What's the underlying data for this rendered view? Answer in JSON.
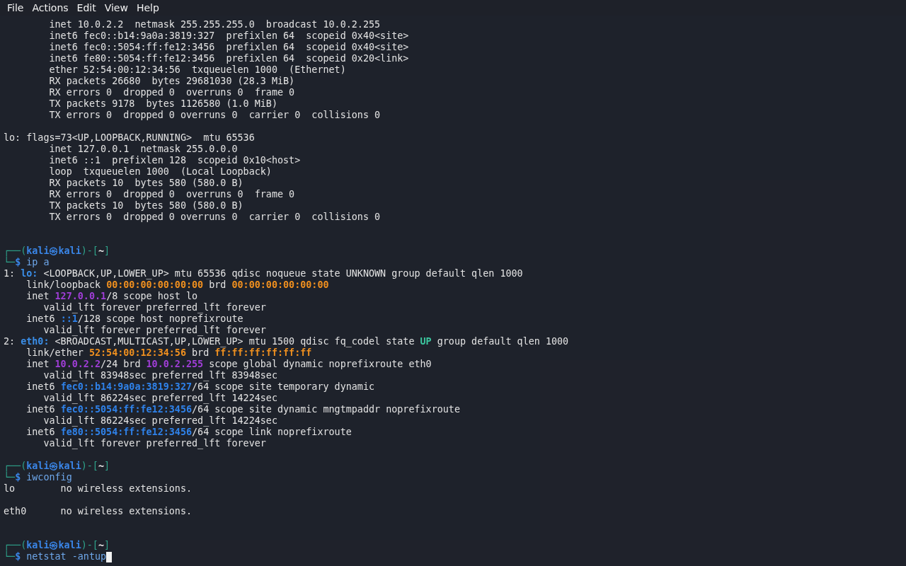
{
  "menu_bar": {
    "items": [
      "File",
      "Actions",
      "Edit",
      "View",
      "Help"
    ]
  },
  "terminal": {
    "lines": [
      {
        "segments": [
          {
            "text": "        inet 10.0.2.2  netmask 255.255.255.0  broadcast 10.0.2.255",
            "kind": "plain"
          }
        ]
      },
      {
        "segments": [
          {
            "text": "        inet6 fec0::b14:9a0a:3819:327  prefixlen 64  scopeid 0x40<site>",
            "kind": "plain"
          }
        ]
      },
      {
        "segments": [
          {
            "text": "        inet6 fec0::5054:ff:fe12:3456  prefixlen 64  scopeid 0x40<site>",
            "kind": "plain"
          }
        ]
      },
      {
        "segments": [
          {
            "text": "        inet6 fe80::5054:ff:fe12:3456  prefixlen 64  scopeid 0x20<link>",
            "kind": "plain"
          }
        ]
      },
      {
        "segments": [
          {
            "text": "        ether 52:54:00:12:34:56  txqueuelen 1000  (Ethernet)",
            "kind": "plain"
          }
        ]
      },
      {
        "segments": [
          {
            "text": "        RX packets 26680  bytes 29681030 (28.3 MiB)",
            "kind": "plain"
          }
        ]
      },
      {
        "segments": [
          {
            "text": "        RX errors 0  dropped 0  overruns 0  frame 0",
            "kind": "plain"
          }
        ]
      },
      {
        "segments": [
          {
            "text": "        TX packets 9178  bytes 1126580 (1.0 MiB)",
            "kind": "plain"
          }
        ]
      },
      {
        "segments": [
          {
            "text": "        TX errors 0  dropped 0 overruns 0  carrier 0  collisions 0",
            "kind": "plain"
          }
        ]
      },
      {
        "kind": "blank"
      },
      {
        "segments": [
          {
            "text": "lo: flags=73<UP,LOOPBACK,RUNNING>  mtu 65536",
            "kind": "plain"
          }
        ]
      },
      {
        "segments": [
          {
            "text": "        inet 127.0.0.1  netmask 255.0.0.0",
            "kind": "plain"
          }
        ]
      },
      {
        "segments": [
          {
            "text": "        inet6 ::1  prefixlen 128  scopeid 0x10<host>",
            "kind": "plain"
          }
        ]
      },
      {
        "segments": [
          {
            "text": "        loop  txqueuelen 1000  (Local Loopback)",
            "kind": "plain"
          }
        ]
      },
      {
        "segments": [
          {
            "text": "        RX packets 10  bytes 580 (580.0 B)",
            "kind": "plain"
          }
        ]
      },
      {
        "segments": [
          {
            "text": "        RX errors 0  dropped 0  overruns 0  frame 0",
            "kind": "plain"
          }
        ]
      },
      {
        "segments": [
          {
            "text": "        TX packets 10  bytes 580 (580.0 B)",
            "kind": "plain"
          }
        ]
      },
      {
        "segments": [
          {
            "text": "        TX errors 0  dropped 0 overruns 0  carrier 0  collisions 0",
            "kind": "plain"
          }
        ]
      },
      {
        "kind": "blank"
      },
      {
        "kind": "blank"
      },
      {
        "segments": [
          {
            "text": "┌──(",
            "kind": "frame"
          },
          {
            "text": "kali㉿kali",
            "kind": "user"
          },
          {
            "text": ")-[",
            "kind": "frame"
          },
          {
            "text": "~",
            "kind": "dir"
          },
          {
            "text": "]",
            "kind": "frame"
          }
        ]
      },
      {
        "segments": [
          {
            "text": "└─",
            "kind": "frame"
          },
          {
            "text": "$",
            "kind": "user"
          },
          {
            "text": " ip a",
            "kind": "command"
          }
        ]
      },
      {
        "segments": [
          {
            "text": "1: ",
            "kind": "plain"
          },
          {
            "text": "lo:",
            "kind": "iface"
          },
          {
            "text": " <LOOPBACK,UP,LOWER_UP> mtu 65536 qdisc noqueue state UNKNOWN group default qlen 1000",
            "kind": "plain"
          }
        ]
      },
      {
        "segments": [
          {
            "text": "    link/loopback ",
            "kind": "plain"
          },
          {
            "text": "00:00:00:00:00:00",
            "kind": "mac"
          },
          {
            "text": " brd ",
            "kind": "plain"
          },
          {
            "text": "00:00:00:00:00:00",
            "kind": "mac"
          }
        ]
      },
      {
        "segments": [
          {
            "text": "    inet ",
            "kind": "plain"
          },
          {
            "text": "127.0.0.1",
            "kind": "ipv4"
          },
          {
            "text": "/8 scope host lo",
            "kind": "plain"
          }
        ]
      },
      {
        "segments": [
          {
            "text": "       valid_lft forever preferred_lft forever",
            "kind": "plain"
          }
        ]
      },
      {
        "segments": [
          {
            "text": "    inet6 ",
            "kind": "plain"
          },
          {
            "text": "::1",
            "kind": "ipv6"
          },
          {
            "text": "/128 scope host noprefixroute",
            "kind": "plain"
          }
        ]
      },
      {
        "segments": [
          {
            "text": "       valid_lft forever preferred_lft forever",
            "kind": "plain"
          }
        ]
      },
      {
        "segments": [
          {
            "text": "2: ",
            "kind": "plain"
          },
          {
            "text": "eth0:",
            "kind": "iface"
          },
          {
            "text": " <BROADCAST,MULTICAST,UP,LOWER_UP> mtu 1500 qdisc fq_codel state ",
            "kind": "plain"
          },
          {
            "text": "UP",
            "kind": "state"
          },
          {
            "text": " group default qlen 1000",
            "kind": "plain"
          }
        ]
      },
      {
        "segments": [
          {
            "text": "    link/ether ",
            "kind": "plain"
          },
          {
            "text": "52:54:00:12:34:56",
            "kind": "mac"
          },
          {
            "text": " brd ",
            "kind": "plain"
          },
          {
            "text": "ff:ff:ff:ff:ff:ff",
            "kind": "mac"
          }
        ]
      },
      {
        "segments": [
          {
            "text": "    inet ",
            "kind": "plain"
          },
          {
            "text": "10.0.2.2",
            "kind": "ipv4"
          },
          {
            "text": "/24 brd ",
            "kind": "plain"
          },
          {
            "text": "10.0.2.255",
            "kind": "ipv4"
          },
          {
            "text": " scope global dynamic noprefixroute eth0",
            "kind": "plain"
          }
        ]
      },
      {
        "segments": [
          {
            "text": "       valid_lft 83948sec preferred_lft 83948sec",
            "kind": "plain"
          }
        ]
      },
      {
        "segments": [
          {
            "text": "    inet6 ",
            "kind": "plain"
          },
          {
            "text": "fec0::b14:9a0a:3819:327",
            "kind": "ipv6"
          },
          {
            "text": "/64 scope site temporary dynamic",
            "kind": "plain"
          }
        ]
      },
      {
        "segments": [
          {
            "text": "       valid_lft 86224sec preferred_lft 14224sec",
            "kind": "plain"
          }
        ]
      },
      {
        "segments": [
          {
            "text": "    inet6 ",
            "kind": "plain"
          },
          {
            "text": "fec0::5054:ff:fe12:3456",
            "kind": "ipv6"
          },
          {
            "text": "/64 scope site dynamic mngtmpaddr noprefixroute",
            "kind": "plain"
          }
        ]
      },
      {
        "segments": [
          {
            "text": "       valid_lft 86224sec preferred_lft 14224sec",
            "kind": "plain"
          }
        ]
      },
      {
        "segments": [
          {
            "text": "    inet6 ",
            "kind": "plain"
          },
          {
            "text": "fe80::5054:ff:fe12:3456",
            "kind": "ipv6"
          },
          {
            "text": "/64 scope link noprefixroute",
            "kind": "plain"
          }
        ]
      },
      {
        "segments": [
          {
            "text": "       valid_lft forever preferred_lft forever",
            "kind": "plain"
          }
        ]
      },
      {
        "kind": "blank"
      },
      {
        "segments": [
          {
            "text": "┌──(",
            "kind": "frame"
          },
          {
            "text": "kali㉿kali",
            "kind": "user"
          },
          {
            "text": ")-[",
            "kind": "frame"
          },
          {
            "text": "~",
            "kind": "dir"
          },
          {
            "text": "]",
            "kind": "frame"
          }
        ]
      },
      {
        "segments": [
          {
            "text": "└─",
            "kind": "frame"
          },
          {
            "text": "$",
            "kind": "user"
          },
          {
            "text": " iwconfig",
            "kind": "command"
          }
        ]
      },
      {
        "segments": [
          {
            "text": "lo        no wireless extensions.",
            "kind": "plain"
          }
        ]
      },
      {
        "kind": "blank"
      },
      {
        "segments": [
          {
            "text": "eth0      no wireless extensions.",
            "kind": "plain"
          }
        ]
      },
      {
        "kind": "blank"
      },
      {
        "kind": "blank"
      },
      {
        "segments": [
          {
            "text": "┌──(",
            "kind": "frame"
          },
          {
            "text": "kali㉿kali",
            "kind": "user"
          },
          {
            "text": ")-[",
            "kind": "frame"
          },
          {
            "text": "~",
            "kind": "dir"
          },
          {
            "text": "]",
            "kind": "frame"
          }
        ]
      },
      {
        "segments": [
          {
            "text": "└─",
            "kind": "frame"
          },
          {
            "text": "$",
            "kind": "user"
          },
          {
            "text": " netstat -antup",
            "kind": "command"
          }
        ],
        "cursor": true
      }
    ]
  }
}
